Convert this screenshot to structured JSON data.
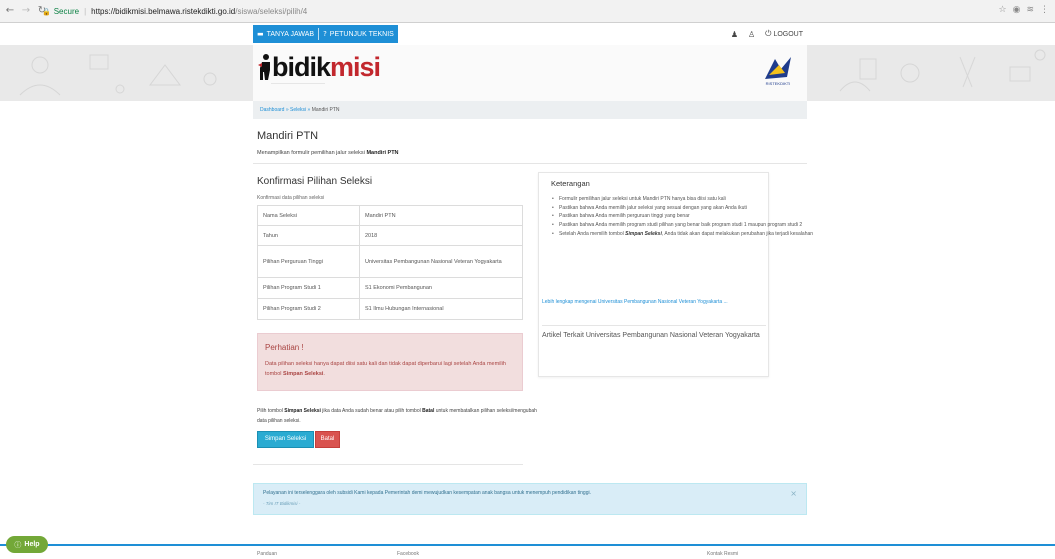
{
  "browser": {
    "secure_label": "Secure",
    "url_host": "https://bidikmisi.belmawa.ristekdikti.go.id",
    "url_path": "/siswa/seleksi/pilih/4",
    "back_icon": "back-arrow-icon",
    "forward_icon": "forward-arrow-icon",
    "reload_icon": "reload-icon",
    "star_icon": "star-icon"
  },
  "topbar": {
    "tanya_jawab": "TANYA JAWAB",
    "petunjuk_teknis": "PETUNJUK TEKNIS",
    "logout": "LOGOUT"
  },
  "header": {
    "logo_bidik": "bidik",
    "logo_misi": "misi",
    "ristekdikti": "RISTEKDIKTI"
  },
  "breadcrumb": {
    "dashboard": "Dashboard",
    "seleksi": "Seleksi",
    "current": "Mandiri PTN"
  },
  "page": {
    "title": "Mandiri PTN",
    "subtitle_prefix": "Menampilkan formulir pemilihan jalur seleksi ",
    "subtitle_bold": "Mandiri PTN"
  },
  "confirm": {
    "title": "Konfirmasi Pilihan Seleksi",
    "subtitle": "Konfirmasi data pilihan seleksi",
    "rows": [
      {
        "label": "Nama Seleksi",
        "value": "Mandiri PTN"
      },
      {
        "label": "Tahun",
        "value": "2018"
      },
      {
        "label": "Pilihan Perguruan Tinggi",
        "value": "Universitas Pembangunan Nasional Veteran Yogyakarta"
      },
      {
        "label": "Pilihan Program Studi 1",
        "value": "S1 Ekonomi Pembangunan"
      },
      {
        "label": "Pilihan Program Studi 2",
        "value": "S1 Ilmu Hubungan Internasional"
      }
    ]
  },
  "alert": {
    "title": "Perhatian !",
    "text_prefix": "Data pilihan seleksi hanya dapat diisi satu kali dan tidak dapat diperbarui lagi setelah Anda memilih tombol ",
    "text_bold": "Simpan Seleksi",
    "text_suffix": "."
  },
  "note": {
    "p1": "Pilih tombol ",
    "b1": "Simpan Seleksi",
    "p2": " jika data Anda sudah benar atau pilih tombol ",
    "b2": "Batal",
    "p3": " untuk membatalkan pilihan seleksi/mengubah data pilihan seleksi."
  },
  "buttons": {
    "save": "Simpan Seleksi",
    "cancel": "Batal"
  },
  "keterangan": {
    "title": "Keterangan",
    "items": [
      "Formulir pemilihan jalur seleksi untuk Mandiri PTN hanya bisa diisi satu kali",
      "Pastikan bahwa Anda memilih jalur seleksi yang sesuai dengan yang akan Anda ikuti",
      "Pastikan bahwa Anda memilih perguruan tinggi yang benar",
      "Pastikan bahwa Anda memilih program studi pilihan yang benar baik program studi 1 maupun program studi 2"
    ],
    "last_prefix": "Setelah Anda memilih tombol ",
    "last_bold": "Simpan Seleksi",
    "last_suffix": ", Anda tidak akan dapat melakukan perubahan jika terjadi kesalahan",
    "link": "Lebih lengkap mengenai Universitas Pembangunan Nasional Veteran Yogyakarta ...",
    "article": "Artikel Terkait Universitas Pembangunan Nasional Veteran Yogyakarta"
  },
  "info": {
    "text": "Pelayanan ini terselenggara oleh subsidi Kami kepada Pemerintah demi mewujudkan kesempatan anak bangsa untuk menempuh pendidikan tinggi.",
    "signature": "- Tim IT Bidikmisi -"
  },
  "footer": {
    "col1": "Panduan",
    "col2": "Facebook",
    "col3": "Kontak Resmi"
  },
  "help": {
    "label": "Help"
  }
}
